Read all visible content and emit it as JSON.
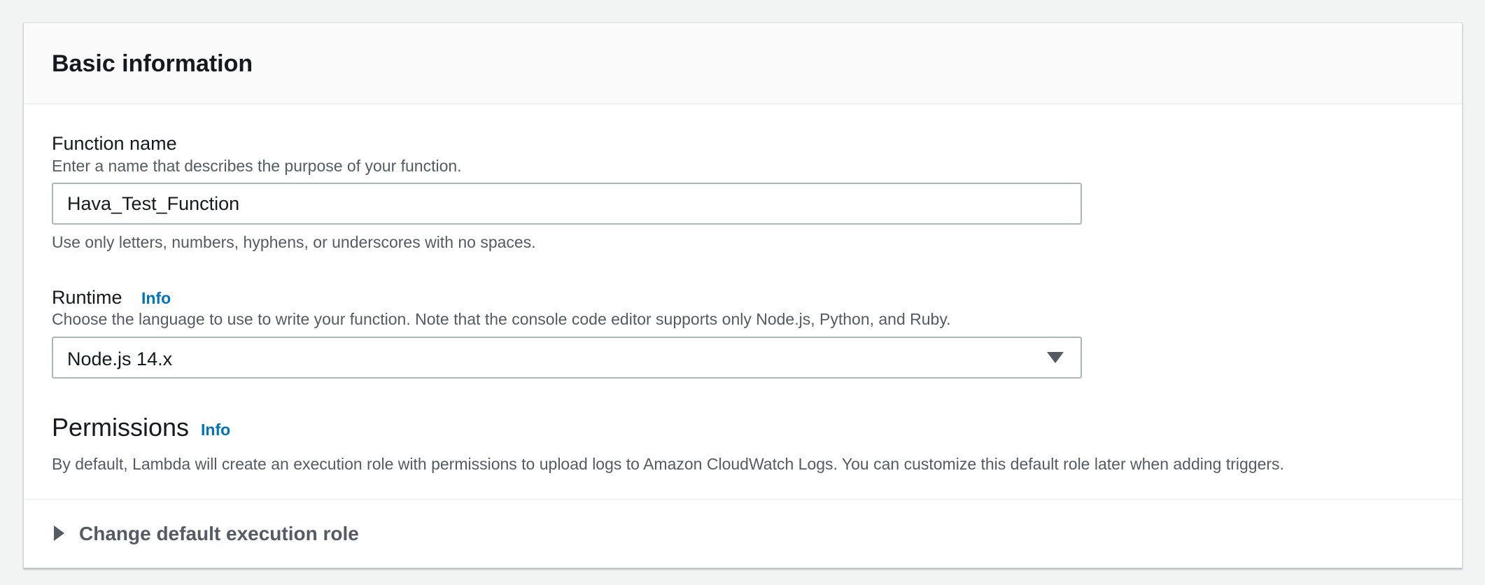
{
  "section": {
    "title": "Basic information"
  },
  "function_name": {
    "label": "Function name",
    "description": "Enter a name that describes the purpose of your function.",
    "value": "Hava_Test_Function",
    "constraint": "Use only letters, numbers, hyphens, or underscores with no spaces."
  },
  "runtime": {
    "label": "Runtime",
    "info": "Info",
    "description": "Choose the language to use to write your function. Note that the console code editor supports only Node.js, Python, and Ruby.",
    "selected": "Node.js 14.x"
  },
  "permissions": {
    "heading": "Permissions",
    "info": "Info",
    "description": "By default, Lambda will create an execution role with permissions to upload logs to Amazon CloudWatch Logs. You can customize this default role later when adding triggers."
  },
  "execution_role": {
    "label": "Change default execution role"
  },
  "colors": {
    "link": "#0073bb",
    "text": "#16191f",
    "secondary_text": "#545b64",
    "border": "#aab7b8",
    "background": "#f2f3f3"
  },
  "icons": {
    "select_caret": "caret-down-icon",
    "expander_caret": "caret-right-icon"
  }
}
